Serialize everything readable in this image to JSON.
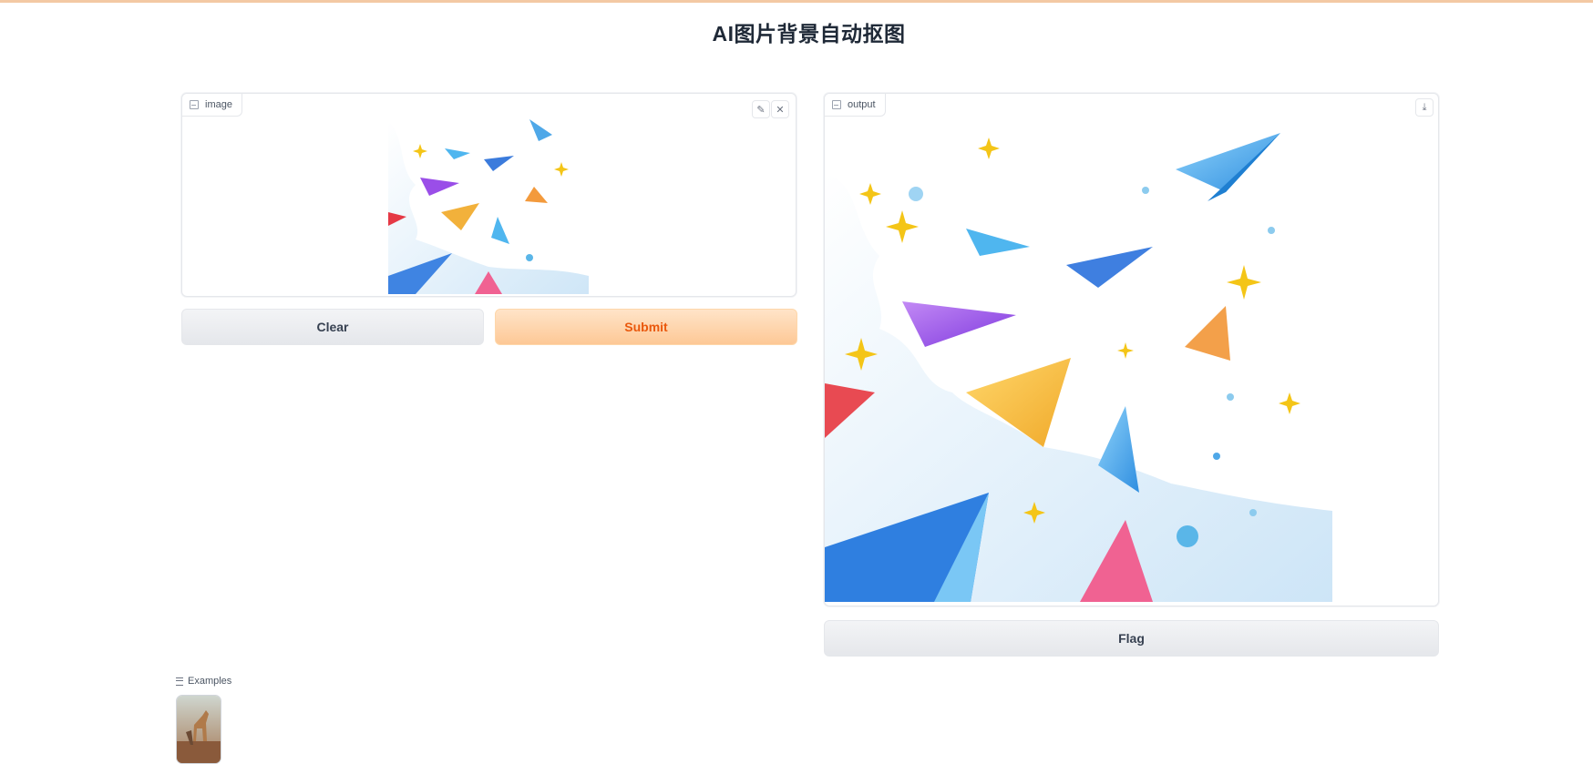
{
  "page": {
    "title": "AI图片背景自动抠图"
  },
  "input_panel": {
    "label": "image",
    "edit_icon": "pencil-icon",
    "close_icon": "close-icon"
  },
  "output_panel": {
    "label": "output",
    "download_icon": "download-icon"
  },
  "buttons": {
    "clear": "Clear",
    "submit": "Submit",
    "flag": "Flag"
  },
  "examples": {
    "label": "Examples",
    "items": [
      {
        "thumbnail": "giraffe-photo"
      }
    ]
  },
  "colors": {
    "accent": "#ea580c",
    "primary_bg": "#fdc896",
    "secondary_bg": "#e5e7eb",
    "border": "#e5e7eb"
  }
}
